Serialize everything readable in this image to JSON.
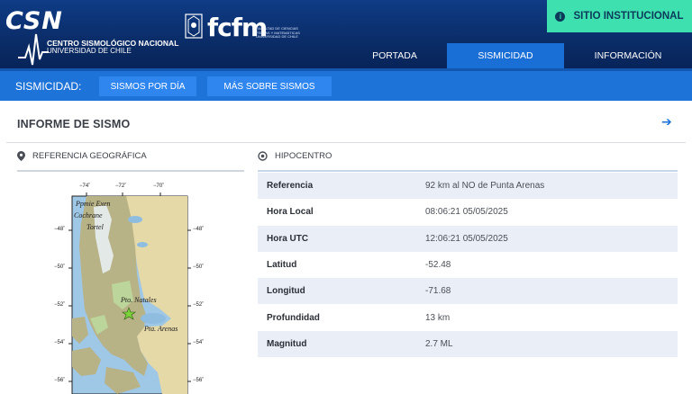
{
  "header": {
    "csn_logo": "CSN",
    "csn_name": "CENTRO SISMOLÓGICO NACIONAL",
    "csn_subname": "UNIVERSIDAD DE CHILE",
    "fcfm_logo": "fcfm",
    "fcfm_caption": "FACULTAD DE CIENCIAS FÍSICAS Y MATEMÁTICAS UNIVERSIDAD DE CHILE",
    "institutional_button": "SITIO INSTITUCIONAL",
    "nav": [
      {
        "label": "PORTADA"
      },
      {
        "label": "SISMICIDAD",
        "active": true
      },
      {
        "label": "INFORMACIÓN"
      }
    ]
  },
  "subnav": {
    "label": "SISMICIDAD:",
    "buttons": [
      {
        "label": "SISMOS POR DÍA"
      },
      {
        "label": "MÁS SOBRE SISMOS"
      }
    ]
  },
  "page": {
    "title": "INFORME DE SISMO",
    "geo_section": "REFERENCIA GEOGRÁFICA",
    "hipo_section": "HIPOCENTRO"
  },
  "map": {
    "top_ticks": [
      "−74˚",
      "−72˚",
      "−70˚"
    ],
    "left_ticks": [
      "−48˚",
      "−50˚",
      "−52˚",
      "−54˚",
      "−56˚"
    ],
    "right_ticks": [
      "−48˚",
      "−50˚",
      "−52˚",
      "−54˚",
      "−56˚"
    ],
    "places": [
      "Ppmie Exen",
      "Cochrane",
      "Tortel",
      "Pto. Natales",
      "Pta. Arenas"
    ]
  },
  "hipocentro": {
    "rows": [
      {
        "key": "Referencia",
        "value": "92 km al NO de Punta Arenas"
      },
      {
        "key": "Hora Local",
        "value": "08:06:21 05/05/2025"
      },
      {
        "key": "Hora UTC",
        "value": "12:06:21 05/05/2025"
      },
      {
        "key": "Latitud",
        "value": "-52.48"
      },
      {
        "key": "Longitud",
        "value": "-71.68"
      },
      {
        "key": "Profundidad",
        "value": "13 km"
      },
      {
        "key": "Magnitud",
        "value": "2.7 ML"
      }
    ]
  },
  "colors": {
    "header_bg": "#0b2e6e",
    "accent_blue": "#1e73d8",
    "institutional_green": "#3ee0b0"
  },
  "icons": {
    "institutional": "info-icon",
    "geo": "map-pin-icon",
    "hipo": "target-icon",
    "back": "arrow-left-icon",
    "epicenter": "star-icon"
  }
}
